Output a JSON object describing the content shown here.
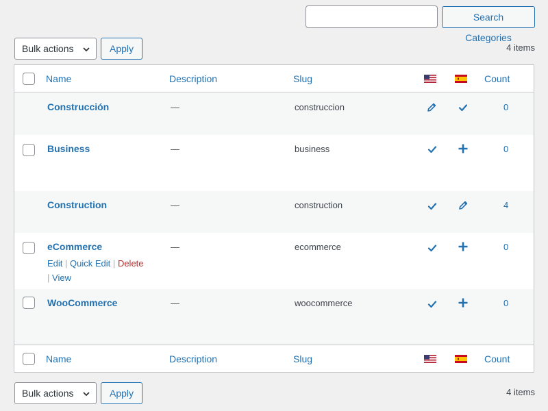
{
  "search": {
    "placeholder": "",
    "value": "",
    "button_label": "Search Categories"
  },
  "bulk": {
    "label": "Bulk actions",
    "apply_label": "Apply"
  },
  "items_count": "4 items",
  "columns": {
    "name": "Name",
    "description": "Description",
    "slug": "Slug",
    "flag_en_icon": "us-flag-icon",
    "flag_es_icon": "es-flag-icon",
    "count": "Count"
  },
  "rows": [
    {
      "name": "Construcción",
      "description": "—",
      "slug": "construccion",
      "en_icon": "pencil-icon",
      "es_icon": "check-icon",
      "count": "0",
      "has_checkbox": false
    },
    {
      "name": "Business",
      "description": "—",
      "slug": "business",
      "en_icon": "check-icon",
      "es_icon": "plus-icon",
      "count": "0",
      "has_checkbox": true
    },
    {
      "name": "Construction",
      "description": "—",
      "slug": "construction",
      "en_icon": "check-icon",
      "es_icon": "pencil-icon",
      "count": "4",
      "has_checkbox": false
    },
    {
      "name": "eCommerce",
      "description": "—",
      "slug": "ecommerce",
      "en_icon": "check-icon",
      "es_icon": "plus-icon",
      "count": "0",
      "has_checkbox": true
    },
    {
      "name": "WooCommerce",
      "description": "—",
      "slug": "woocommerce",
      "en_icon": "check-icon",
      "es_icon": "plus-icon",
      "count": "0",
      "has_checkbox": true
    }
  ],
  "row_actions": {
    "edit": "Edit",
    "quick_edit": "Quick Edit",
    "delete": "Delete",
    "view": "View",
    "separator": "|"
  },
  "colors": {
    "accent": "#2271b1",
    "danger": "#b32d2e",
    "border": "#c3c4c7",
    "background": "#f0f0f1"
  }
}
